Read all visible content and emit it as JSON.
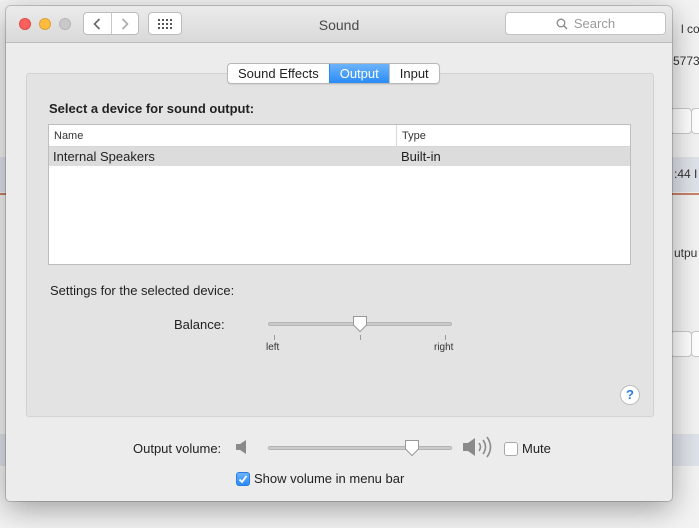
{
  "window": {
    "title": "Sound",
    "search_placeholder": "Search"
  },
  "tabs": [
    {
      "label": "Sound Effects",
      "active": false
    },
    {
      "label": "Output",
      "active": true
    },
    {
      "label": "Input",
      "active": false
    }
  ],
  "output": {
    "section_label": "Select a device for sound output:",
    "columns": [
      "Name",
      "Type"
    ],
    "devices": [
      {
        "name": "Internal Speakers",
        "type": "Built-in",
        "selected": true
      }
    ],
    "settings_label": "Settings for the selected device:",
    "balance_label": "Balance:",
    "balance_value": 0.5,
    "balance_left": "left",
    "balance_right": "right"
  },
  "footer": {
    "volume_label": "Output volume:",
    "volume_value": 0.78,
    "mute_label": "Mute",
    "mute_checked": false,
    "menu_bar_label": "Show volume in menu bar",
    "menu_bar_checked": true
  },
  "background_text": {
    "top_right": "l co",
    "id_fragment": "5773",
    "time_fragment": ":44 I",
    "side_fragment": "utpu"
  },
  "icons": {
    "back": "chevron-left-icon",
    "forward": "chevron-right-icon",
    "grid": "grid-icon",
    "search": "search-icon",
    "help": "help-icon",
    "speaker_low": "speaker-low-icon",
    "speaker_high": "speaker-high-icon"
  },
  "colors": {
    "accent": "#2a8cf6",
    "close": "#fc605c",
    "minimize": "#fdbc40"
  }
}
